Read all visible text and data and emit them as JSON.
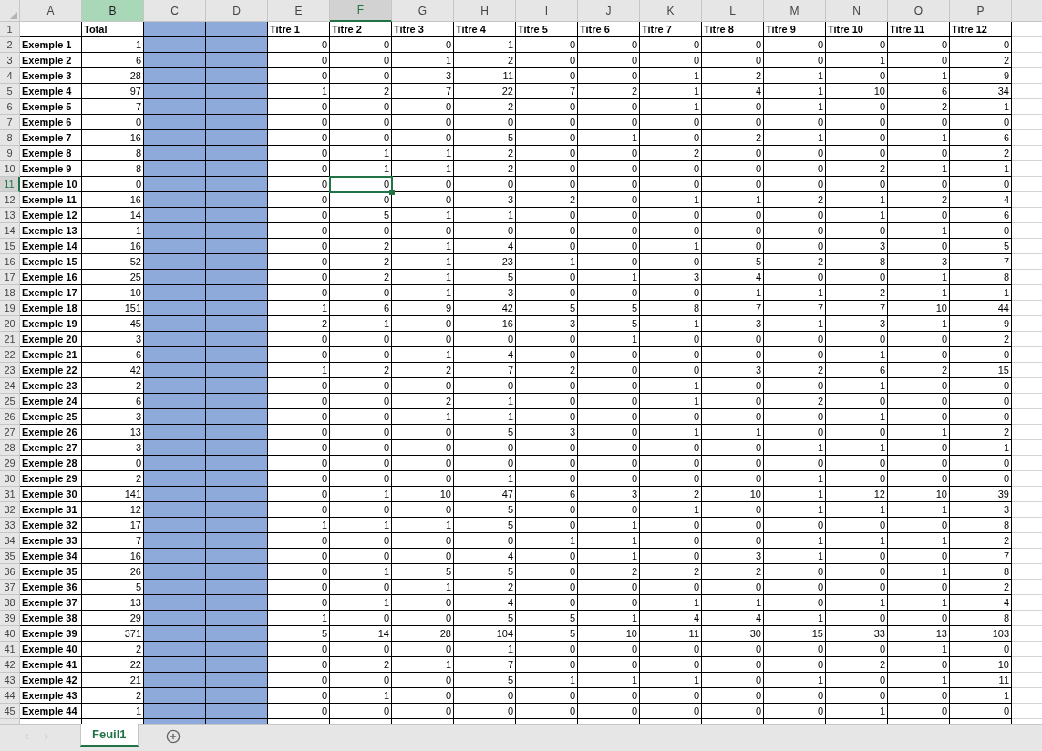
{
  "columns": [
    {
      "label": "A",
      "kind": "label",
      "selected": false,
      "highlighted": false
    },
    {
      "label": "B",
      "kind": "total",
      "selected": false,
      "highlighted": true
    },
    {
      "label": "C",
      "kind": "blank",
      "selected": false,
      "highlighted": false
    },
    {
      "label": "D",
      "kind": "blank",
      "selected": false,
      "highlighted": false
    },
    {
      "label": "E",
      "kind": "number",
      "selected": false,
      "highlighted": false
    },
    {
      "label": "F",
      "kind": "number",
      "selected": true,
      "highlighted": false
    },
    {
      "label": "G",
      "kind": "number",
      "selected": false,
      "highlighted": false
    },
    {
      "label": "H",
      "kind": "number",
      "selected": false,
      "highlighted": false
    },
    {
      "label": "I",
      "kind": "number",
      "selected": false,
      "highlighted": false
    },
    {
      "label": "J",
      "kind": "number",
      "selected": false,
      "highlighted": false
    },
    {
      "label": "K",
      "kind": "number",
      "selected": false,
      "highlighted": false
    },
    {
      "label": "L",
      "kind": "number",
      "selected": false,
      "highlighted": false
    },
    {
      "label": "M",
      "kind": "number",
      "selected": false,
      "highlighted": false
    },
    {
      "label": "N",
      "kind": "number",
      "selected": false,
      "highlighted": false
    },
    {
      "label": "O",
      "kind": "number",
      "selected": false,
      "highlighted": false
    },
    {
      "label": "P",
      "kind": "number",
      "selected": false,
      "highlighted": false
    }
  ],
  "header_row": {
    "number": "1",
    "total": "Total",
    "titles": [
      "Titre 1",
      "Titre 2",
      "Titre 3",
      "Titre 4",
      "Titre 5",
      "Titre 6",
      "Titre 7",
      "Titre 8",
      "Titre 9",
      "Titre 10",
      "Titre 11",
      "Titre 12"
    ]
  },
  "rows": [
    {
      "number": "2",
      "name": "Exemple 1",
      "total": "1",
      "values": [
        "0",
        "0",
        "0",
        "1",
        "0",
        "0",
        "0",
        "0",
        "0",
        "0",
        "0",
        "0"
      ],
      "selected": false
    },
    {
      "number": "3",
      "name": "Exemple 2",
      "total": "6",
      "values": [
        "0",
        "0",
        "1",
        "2",
        "0",
        "0",
        "0",
        "0",
        "0",
        "1",
        "0",
        "2"
      ],
      "selected": false
    },
    {
      "number": "4",
      "name": "Exemple 3",
      "total": "28",
      "values": [
        "0",
        "0",
        "3",
        "11",
        "0",
        "0",
        "1",
        "2",
        "1",
        "0",
        "1",
        "9"
      ],
      "selected": false
    },
    {
      "number": "5",
      "name": "Exemple 4",
      "total": "97",
      "values": [
        "1",
        "2",
        "7",
        "22",
        "7",
        "2",
        "1",
        "4",
        "1",
        "10",
        "6",
        "34"
      ],
      "selected": false
    },
    {
      "number": "6",
      "name": "Exemple 5",
      "total": "7",
      "values": [
        "0",
        "0",
        "0",
        "2",
        "0",
        "0",
        "1",
        "0",
        "1",
        "0",
        "2",
        "1"
      ],
      "selected": false
    },
    {
      "number": "7",
      "name": "Exemple 6",
      "total": "0",
      "values": [
        "0",
        "0",
        "0",
        "0",
        "0",
        "0",
        "0",
        "0",
        "0",
        "0",
        "0",
        "0"
      ],
      "selected": false
    },
    {
      "number": "8",
      "name": "Exemple 7",
      "total": "16",
      "values": [
        "0",
        "0",
        "0",
        "5",
        "0",
        "1",
        "0",
        "2",
        "1",
        "0",
        "1",
        "6"
      ],
      "selected": false
    },
    {
      "number": "9",
      "name": "Exemple 8",
      "total": "8",
      "values": [
        "0",
        "1",
        "1",
        "2",
        "0",
        "0",
        "2",
        "0",
        "0",
        "0",
        "0",
        "2"
      ],
      "selected": false
    },
    {
      "number": "10",
      "name": "Exemple 9",
      "total": "8",
      "values": [
        "0",
        "1",
        "1",
        "2",
        "0",
        "0",
        "0",
        "0",
        "0",
        "2",
        "1",
        "1"
      ],
      "selected": false
    },
    {
      "number": "11",
      "name": "Exemple 10",
      "total": "0",
      "values": [
        "0",
        "0",
        "0",
        "0",
        "0",
        "0",
        "0",
        "0",
        "0",
        "0",
        "0",
        "0"
      ],
      "selected": true
    },
    {
      "number": "12",
      "name": "Exemple 11",
      "total": "16",
      "values": [
        "0",
        "0",
        "0",
        "3",
        "2",
        "0",
        "1",
        "1",
        "2",
        "1",
        "2",
        "4"
      ],
      "selected": false
    },
    {
      "number": "13",
      "name": "Exemple 12",
      "total": "14",
      "values": [
        "0",
        "5",
        "1",
        "1",
        "0",
        "0",
        "0",
        "0",
        "0",
        "1",
        "0",
        "6"
      ],
      "selected": false
    },
    {
      "number": "14",
      "name": "Exemple 13",
      "total": "1",
      "values": [
        "0",
        "0",
        "0",
        "0",
        "0",
        "0",
        "0",
        "0",
        "0",
        "0",
        "1",
        "0"
      ],
      "selected": false
    },
    {
      "number": "15",
      "name": "Exemple 14",
      "total": "16",
      "values": [
        "0",
        "2",
        "1",
        "4",
        "0",
        "0",
        "1",
        "0",
        "0",
        "3",
        "0",
        "5"
      ],
      "selected": false
    },
    {
      "number": "16",
      "name": "Exemple 15",
      "total": "52",
      "values": [
        "0",
        "2",
        "1",
        "23",
        "1",
        "0",
        "0",
        "5",
        "2",
        "8",
        "3",
        "7"
      ],
      "selected": false
    },
    {
      "number": "17",
      "name": "Exemple 16",
      "total": "25",
      "values": [
        "0",
        "2",
        "1",
        "5",
        "0",
        "1",
        "3",
        "4",
        "0",
        "0",
        "1",
        "8"
      ],
      "selected": false
    },
    {
      "number": "18",
      "name": "Exemple 17",
      "total": "10",
      "values": [
        "0",
        "0",
        "1",
        "3",
        "0",
        "0",
        "0",
        "1",
        "1",
        "2",
        "1",
        "1"
      ],
      "selected": false
    },
    {
      "number": "19",
      "name": "Exemple 18",
      "total": "151",
      "values": [
        "1",
        "6",
        "9",
        "42",
        "5",
        "5",
        "8",
        "7",
        "7",
        "7",
        "10",
        "44"
      ],
      "selected": false
    },
    {
      "number": "20",
      "name": "Exemple 19",
      "total": "45",
      "values": [
        "2",
        "1",
        "0",
        "16",
        "3",
        "5",
        "1",
        "3",
        "1",
        "3",
        "1",
        "9"
      ],
      "selected": false
    },
    {
      "number": "21",
      "name": "Exemple 20",
      "total": "3",
      "values": [
        "0",
        "0",
        "0",
        "0",
        "0",
        "1",
        "0",
        "0",
        "0",
        "0",
        "0",
        "2"
      ],
      "selected": false
    },
    {
      "number": "22",
      "name": "Exemple 21",
      "total": "6",
      "values": [
        "0",
        "0",
        "1",
        "4",
        "0",
        "0",
        "0",
        "0",
        "0",
        "1",
        "0",
        "0"
      ],
      "selected": false
    },
    {
      "number": "23",
      "name": "Exemple 22",
      "total": "42",
      "values": [
        "1",
        "2",
        "2",
        "7",
        "2",
        "0",
        "0",
        "3",
        "2",
        "6",
        "2",
        "15"
      ],
      "selected": false
    },
    {
      "number": "24",
      "name": "Exemple 23",
      "total": "2",
      "values": [
        "0",
        "0",
        "0",
        "0",
        "0",
        "0",
        "1",
        "0",
        "0",
        "1",
        "0",
        "0"
      ],
      "selected": false
    },
    {
      "number": "25",
      "name": "Exemple 24",
      "total": "6",
      "values": [
        "0",
        "0",
        "2",
        "1",
        "0",
        "0",
        "1",
        "0",
        "2",
        "0",
        "0",
        "0"
      ],
      "selected": false
    },
    {
      "number": "26",
      "name": "Exemple 25",
      "total": "3",
      "values": [
        "0",
        "0",
        "1",
        "1",
        "0",
        "0",
        "0",
        "0",
        "0",
        "1",
        "0",
        "0"
      ],
      "selected": false
    },
    {
      "number": "27",
      "name": "Exemple 26",
      "total": "13",
      "values": [
        "0",
        "0",
        "0",
        "5",
        "3",
        "0",
        "1",
        "1",
        "0",
        "0",
        "1",
        "2"
      ],
      "selected": false
    },
    {
      "number": "28",
      "name": "Exemple 27",
      "total": "3",
      "values": [
        "0",
        "0",
        "0",
        "0",
        "0",
        "0",
        "0",
        "0",
        "1",
        "1",
        "0",
        "1"
      ],
      "selected": false
    },
    {
      "number": "29",
      "name": "Exemple 28",
      "total": "0",
      "values": [
        "0",
        "0",
        "0",
        "0",
        "0",
        "0",
        "0",
        "0",
        "0",
        "0",
        "0",
        "0"
      ],
      "selected": false
    },
    {
      "number": "30",
      "name": "Exemple 29",
      "total": "2",
      "values": [
        "0",
        "0",
        "0",
        "1",
        "0",
        "0",
        "0",
        "0",
        "1",
        "0",
        "0",
        "0"
      ],
      "selected": false
    },
    {
      "number": "31",
      "name": "Exemple 30",
      "total": "141",
      "values": [
        "0",
        "1",
        "10",
        "47",
        "6",
        "3",
        "2",
        "10",
        "1",
        "12",
        "10",
        "39"
      ],
      "selected": false
    },
    {
      "number": "32",
      "name": "Exemple 31",
      "total": "12",
      "values": [
        "0",
        "0",
        "0",
        "5",
        "0",
        "0",
        "1",
        "0",
        "1",
        "1",
        "1",
        "3"
      ],
      "selected": false
    },
    {
      "number": "33",
      "name": "Exemple 32",
      "total": "17",
      "values": [
        "1",
        "1",
        "1",
        "5",
        "0",
        "1",
        "0",
        "0",
        "0",
        "0",
        "0",
        "8"
      ],
      "selected": false
    },
    {
      "number": "34",
      "name": "Exemple 33",
      "total": "7",
      "values": [
        "0",
        "0",
        "0",
        "0",
        "1",
        "1",
        "0",
        "0",
        "1",
        "1",
        "1",
        "2"
      ],
      "selected": false
    },
    {
      "number": "35",
      "name": "Exemple 34",
      "total": "16",
      "values": [
        "0",
        "0",
        "0",
        "4",
        "0",
        "1",
        "0",
        "3",
        "1",
        "0",
        "0",
        "7"
      ],
      "selected": false
    },
    {
      "number": "36",
      "name": "Exemple 35",
      "total": "26",
      "values": [
        "0",
        "1",
        "5",
        "5",
        "0",
        "2",
        "2",
        "2",
        "0",
        "0",
        "1",
        "8"
      ],
      "selected": false
    },
    {
      "number": "37",
      "name": "Exemple 36",
      "total": "5",
      "values": [
        "0",
        "0",
        "1",
        "2",
        "0",
        "0",
        "0",
        "0",
        "0",
        "0",
        "0",
        "2"
      ],
      "selected": false
    },
    {
      "number": "38",
      "name": "Exemple 37",
      "total": "13",
      "values": [
        "0",
        "1",
        "0",
        "4",
        "0",
        "0",
        "1",
        "1",
        "0",
        "1",
        "1",
        "4"
      ],
      "selected": false
    },
    {
      "number": "39",
      "name": "Exemple 38",
      "total": "29",
      "values": [
        "1",
        "0",
        "0",
        "5",
        "5",
        "1",
        "4",
        "4",
        "1",
        "0",
        "0",
        "8"
      ],
      "selected": false
    },
    {
      "number": "40",
      "name": "Exemple 39",
      "total": "371",
      "values": [
        "5",
        "14",
        "28",
        "104",
        "5",
        "10",
        "11",
        "30",
        "15",
        "33",
        "13",
        "103"
      ],
      "selected": false
    },
    {
      "number": "41",
      "name": "Exemple 40",
      "total": "2",
      "values": [
        "0",
        "0",
        "0",
        "1",
        "0",
        "0",
        "0",
        "0",
        "0",
        "0",
        "1",
        "0"
      ],
      "selected": false
    },
    {
      "number": "42",
      "name": "Exemple 41",
      "total": "22",
      "values": [
        "0",
        "2",
        "1",
        "7",
        "0",
        "0",
        "0",
        "0",
        "0",
        "2",
        "0",
        "10"
      ],
      "selected": false
    },
    {
      "number": "43",
      "name": "Exemple 42",
      "total": "21",
      "values": [
        "0",
        "0",
        "0",
        "5",
        "1",
        "1",
        "1",
        "0",
        "1",
        "0",
        "1",
        "11"
      ],
      "selected": false
    },
    {
      "number": "44",
      "name": "Exemple 43",
      "total": "2",
      "values": [
        "0",
        "1",
        "0",
        "0",
        "0",
        "0",
        "0",
        "0",
        "0",
        "0",
        "0",
        "1"
      ],
      "selected": false
    },
    {
      "number": "45",
      "name": "Exemple 44",
      "total": "1",
      "values": [
        "0",
        "0",
        "0",
        "0",
        "0",
        "0",
        "0",
        "0",
        "0",
        "1",
        "0",
        "0"
      ],
      "selected": false
    }
  ],
  "sheet_tabs": [
    {
      "label": "Feuil1",
      "selected": true
    }
  ]
}
